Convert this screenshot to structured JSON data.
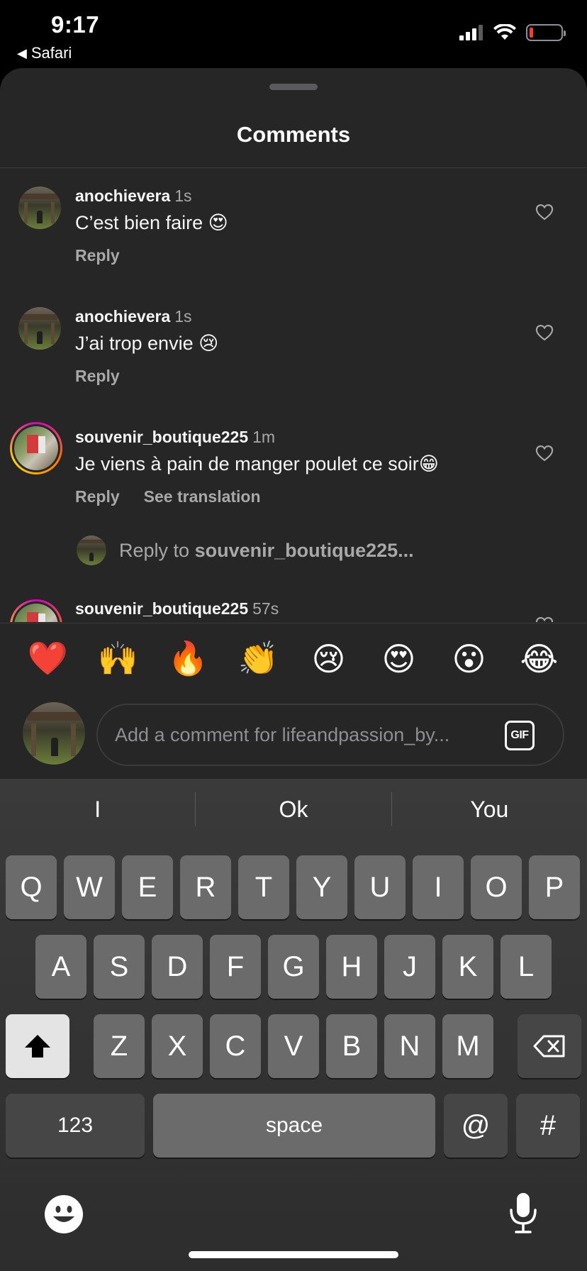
{
  "status_bar": {
    "time": "9:17",
    "back_app": "Safari",
    "battery_color": "#ff3b30"
  },
  "sheet": {
    "title": "Comments"
  },
  "comments": [
    {
      "user": "anochievera",
      "time": "1s",
      "text": "C’est bien faire 😍",
      "actions": [
        "Reply"
      ]
    },
    {
      "user": "anochievera",
      "time": "1s",
      "text": "J’ai trop envie 😢",
      "actions": [
        "Reply"
      ]
    },
    {
      "user": "souvenir_boutique225",
      "time": "1m",
      "text": "Je viens à pain de manger poulet ce soir😁",
      "actions": [
        "Reply",
        "See translation"
      ]
    },
    {
      "user": "souvenir_boutique225",
      "time": "57s",
      "text": "",
      "actions": []
    }
  ],
  "reply_row": {
    "prefix": "Reply to ",
    "target": "souvenir_boutique225..."
  },
  "emoji_bar": [
    "❤️",
    "🙌",
    "🔥",
    "👏",
    "😢",
    "😍",
    "😮",
    "😂"
  ],
  "composer": {
    "placeholder": "Add a comment for lifeandpassion_by...",
    "gif_label": "GIF"
  },
  "keyboard": {
    "predictions": [
      "I",
      "Ok",
      "You"
    ],
    "row1": [
      "Q",
      "W",
      "E",
      "R",
      "T",
      "Y",
      "U",
      "I",
      "O",
      "P"
    ],
    "row2": [
      "A",
      "S",
      "D",
      "F",
      "G",
      "H",
      "J",
      "K",
      "L"
    ],
    "row3": [
      "Z",
      "X",
      "C",
      "V",
      "B",
      "N",
      "M"
    ],
    "numbers_label": "123",
    "space_label": "space",
    "at_label": "@",
    "hash_label": "#"
  },
  "icons": {
    "shift": "shift-icon",
    "backspace": "backspace-icon",
    "emoji": "emoji-keyboard-icon",
    "mic": "microphone-icon",
    "heart": "heart-outline-icon"
  }
}
